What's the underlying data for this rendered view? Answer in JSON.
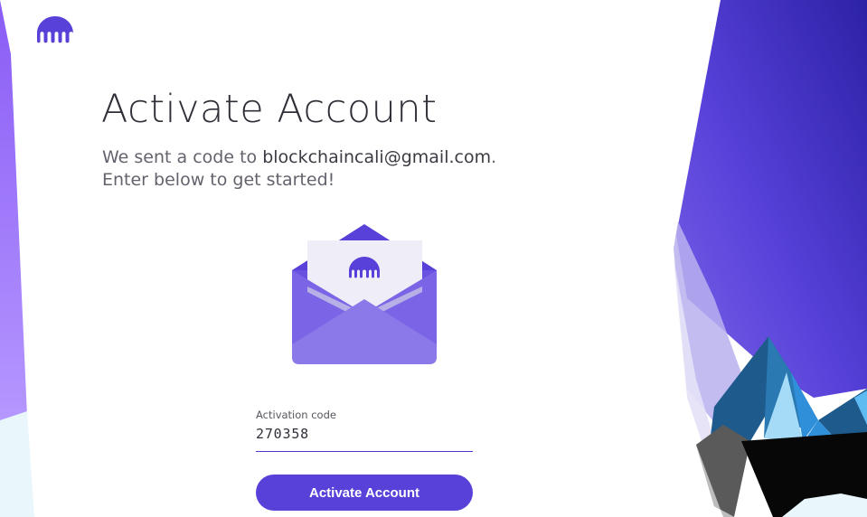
{
  "brand": {
    "logo_icon": "kraken-logo-icon",
    "color": "#5741d9"
  },
  "header": {
    "title": "Activate Account"
  },
  "message": {
    "prefix": "We sent a code to ",
    "email": "blockchaincali@gmail.com",
    "suffix": ".",
    "line2": "Enter below to get started!"
  },
  "illustration": {
    "icon": "envelope-with-letter-icon"
  },
  "form": {
    "code_label": "Activation code",
    "code_value": "270358",
    "submit_label": "Activate Account"
  },
  "colors": {
    "accent": "#5741d9",
    "text_primary": "#2f2f38",
    "text_secondary": "#63636e"
  }
}
